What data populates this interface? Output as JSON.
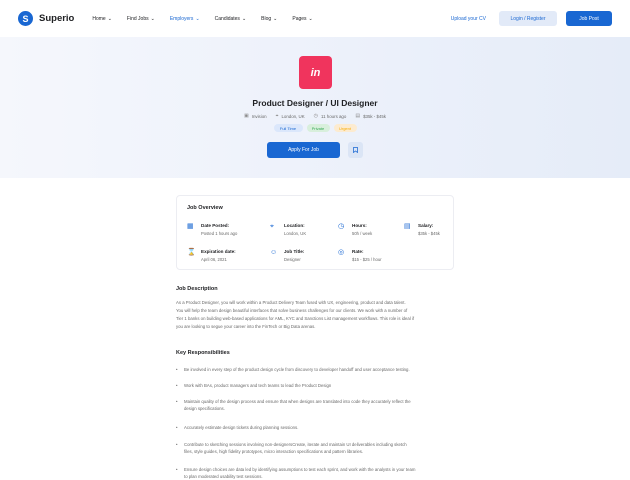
{
  "header": {
    "logo_text": "Superio",
    "nav": [
      {
        "label": "Home",
        "active": false
      },
      {
        "label": "Find Jobs",
        "active": false
      },
      {
        "label": "Employers",
        "active": true
      },
      {
        "label": "Candidates",
        "active": false
      },
      {
        "label": "Blog",
        "active": false
      },
      {
        "label": "Pages",
        "active": false
      }
    ],
    "upload_cv": "Upload your CV",
    "login_register": "Login / Register",
    "job_post": "Job Post"
  },
  "job": {
    "logo_text": "in",
    "title": "Product Designer / UI Designer",
    "company": "Invision",
    "location": "London, UK",
    "posted": "11 hours ago",
    "salary": "$35k - $45k",
    "tags": [
      "Full Time",
      "Private",
      "Urgent"
    ],
    "apply_label": "Apply For Job"
  },
  "overview": {
    "title": "Job Overview",
    "items": [
      {
        "label": "Date Posted:",
        "value": "Posted 1 hours ago"
      },
      {
        "label": "Location:",
        "value": "London, UK"
      },
      {
        "label": "Hours:",
        "value": "50h / week"
      },
      {
        "label": "Salary:",
        "value": "$35k - $45k"
      },
      {
        "label": "Expiration date:",
        "value": "April 06, 2021"
      },
      {
        "label": "Job Title:",
        "value": "Designer"
      },
      {
        "label": "Rate:",
        "value": "$15 - $25 / hour"
      }
    ]
  },
  "description": {
    "title": "Job Description",
    "lines": [
      "As a Product Designer, you will work within a Product Delivery Team fused with UX, engineering, product and data talent.",
      "You will help the team design beautiful interfaces that solve business challenges for our clients. We work with a number of",
      "Tier 1 banks on building web-based applications for AML, KYC and Sanctions List management workflows. This role is ideal if",
      "you are looking to segue your career into the FinTech or Big Data arenas."
    ]
  },
  "responsibilities": {
    "title": "Key Responsibilities",
    "items": [
      [
        "Be involved in every step of the product design cycle from discovery to developer handoff and user acceptance testing."
      ],
      [
        "Work with BAs, product managers and tech teams to lead the Product Design"
      ],
      [
        "Maintain quality of the design process and ensure that when designs are translated into code they accurately reflect the",
        "design specifications."
      ],
      [
        "Accurately estimate design tickets during planning sessions."
      ],
      [
        "Contribute to sketching sessions involving non-designersCreate, iterate and maintain UI deliverables including sketch",
        "files, style guides, high fidelity prototypes, micro interaction specifications and pattern libraries."
      ],
      [
        "Ensure design choices are data led by identifying assumptions to test each sprint, and work with the analysts in your team",
        "to plan moderated usability test sessions."
      ]
    ]
  }
}
